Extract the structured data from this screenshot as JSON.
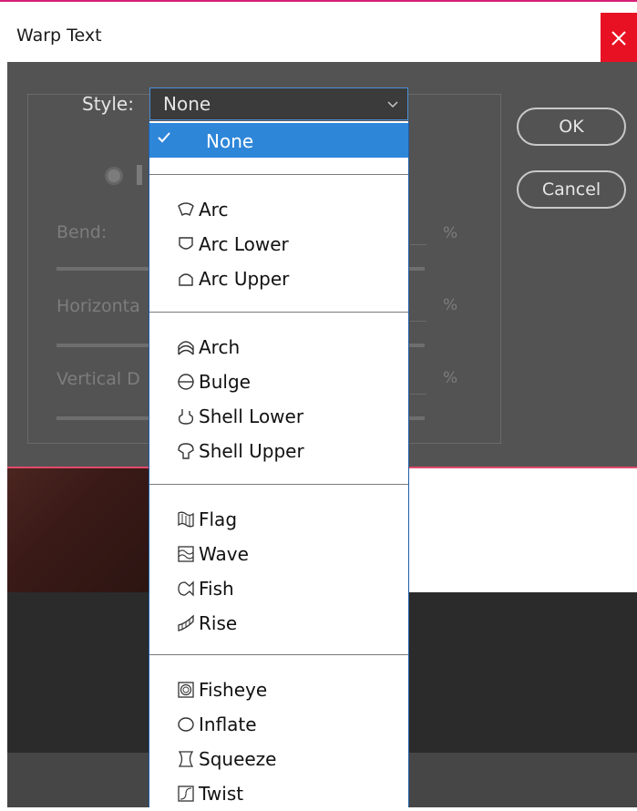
{
  "window": {
    "title": "Warp Text"
  },
  "form": {
    "style_label": "Style:",
    "style_value": "None",
    "bend_label": "Bend:",
    "horizontal_label": "Horizonta",
    "vertical_label": "Vertical D",
    "percent": "%"
  },
  "buttons": {
    "ok": "OK",
    "cancel": "Cancel"
  },
  "dropdown": {
    "selected": "None",
    "items": [
      {
        "label": "None",
        "icon": "check-icon"
      },
      {
        "label": "Arc",
        "icon": "arc-icon"
      },
      {
        "label": "Arc Lower",
        "icon": "arc-lower-icon"
      },
      {
        "label": "Arc Upper",
        "icon": "arc-upper-icon"
      },
      {
        "label": "Arch",
        "icon": "arch-icon"
      },
      {
        "label": "Bulge",
        "icon": "bulge-icon"
      },
      {
        "label": "Shell Lower",
        "icon": "shell-lower-icon"
      },
      {
        "label": "Shell Upper",
        "icon": "shell-upper-icon"
      },
      {
        "label": "Flag",
        "icon": "flag-icon"
      },
      {
        "label": "Wave",
        "icon": "wave-icon"
      },
      {
        "label": "Fish",
        "icon": "fish-icon"
      },
      {
        "label": "Rise",
        "icon": "rise-icon"
      },
      {
        "label": "Fisheye",
        "icon": "fisheye-icon"
      },
      {
        "label": "Inflate",
        "icon": "inflate-icon"
      },
      {
        "label": "Squeeze",
        "icon": "squeeze-icon"
      },
      {
        "label": "Twist",
        "icon": "twist-icon"
      }
    ]
  },
  "colors": {
    "dialog_bg": "#535353",
    "close_red": "#e81123",
    "selection_blue": "#2e86d9",
    "accent_pink": "#d61f76"
  }
}
